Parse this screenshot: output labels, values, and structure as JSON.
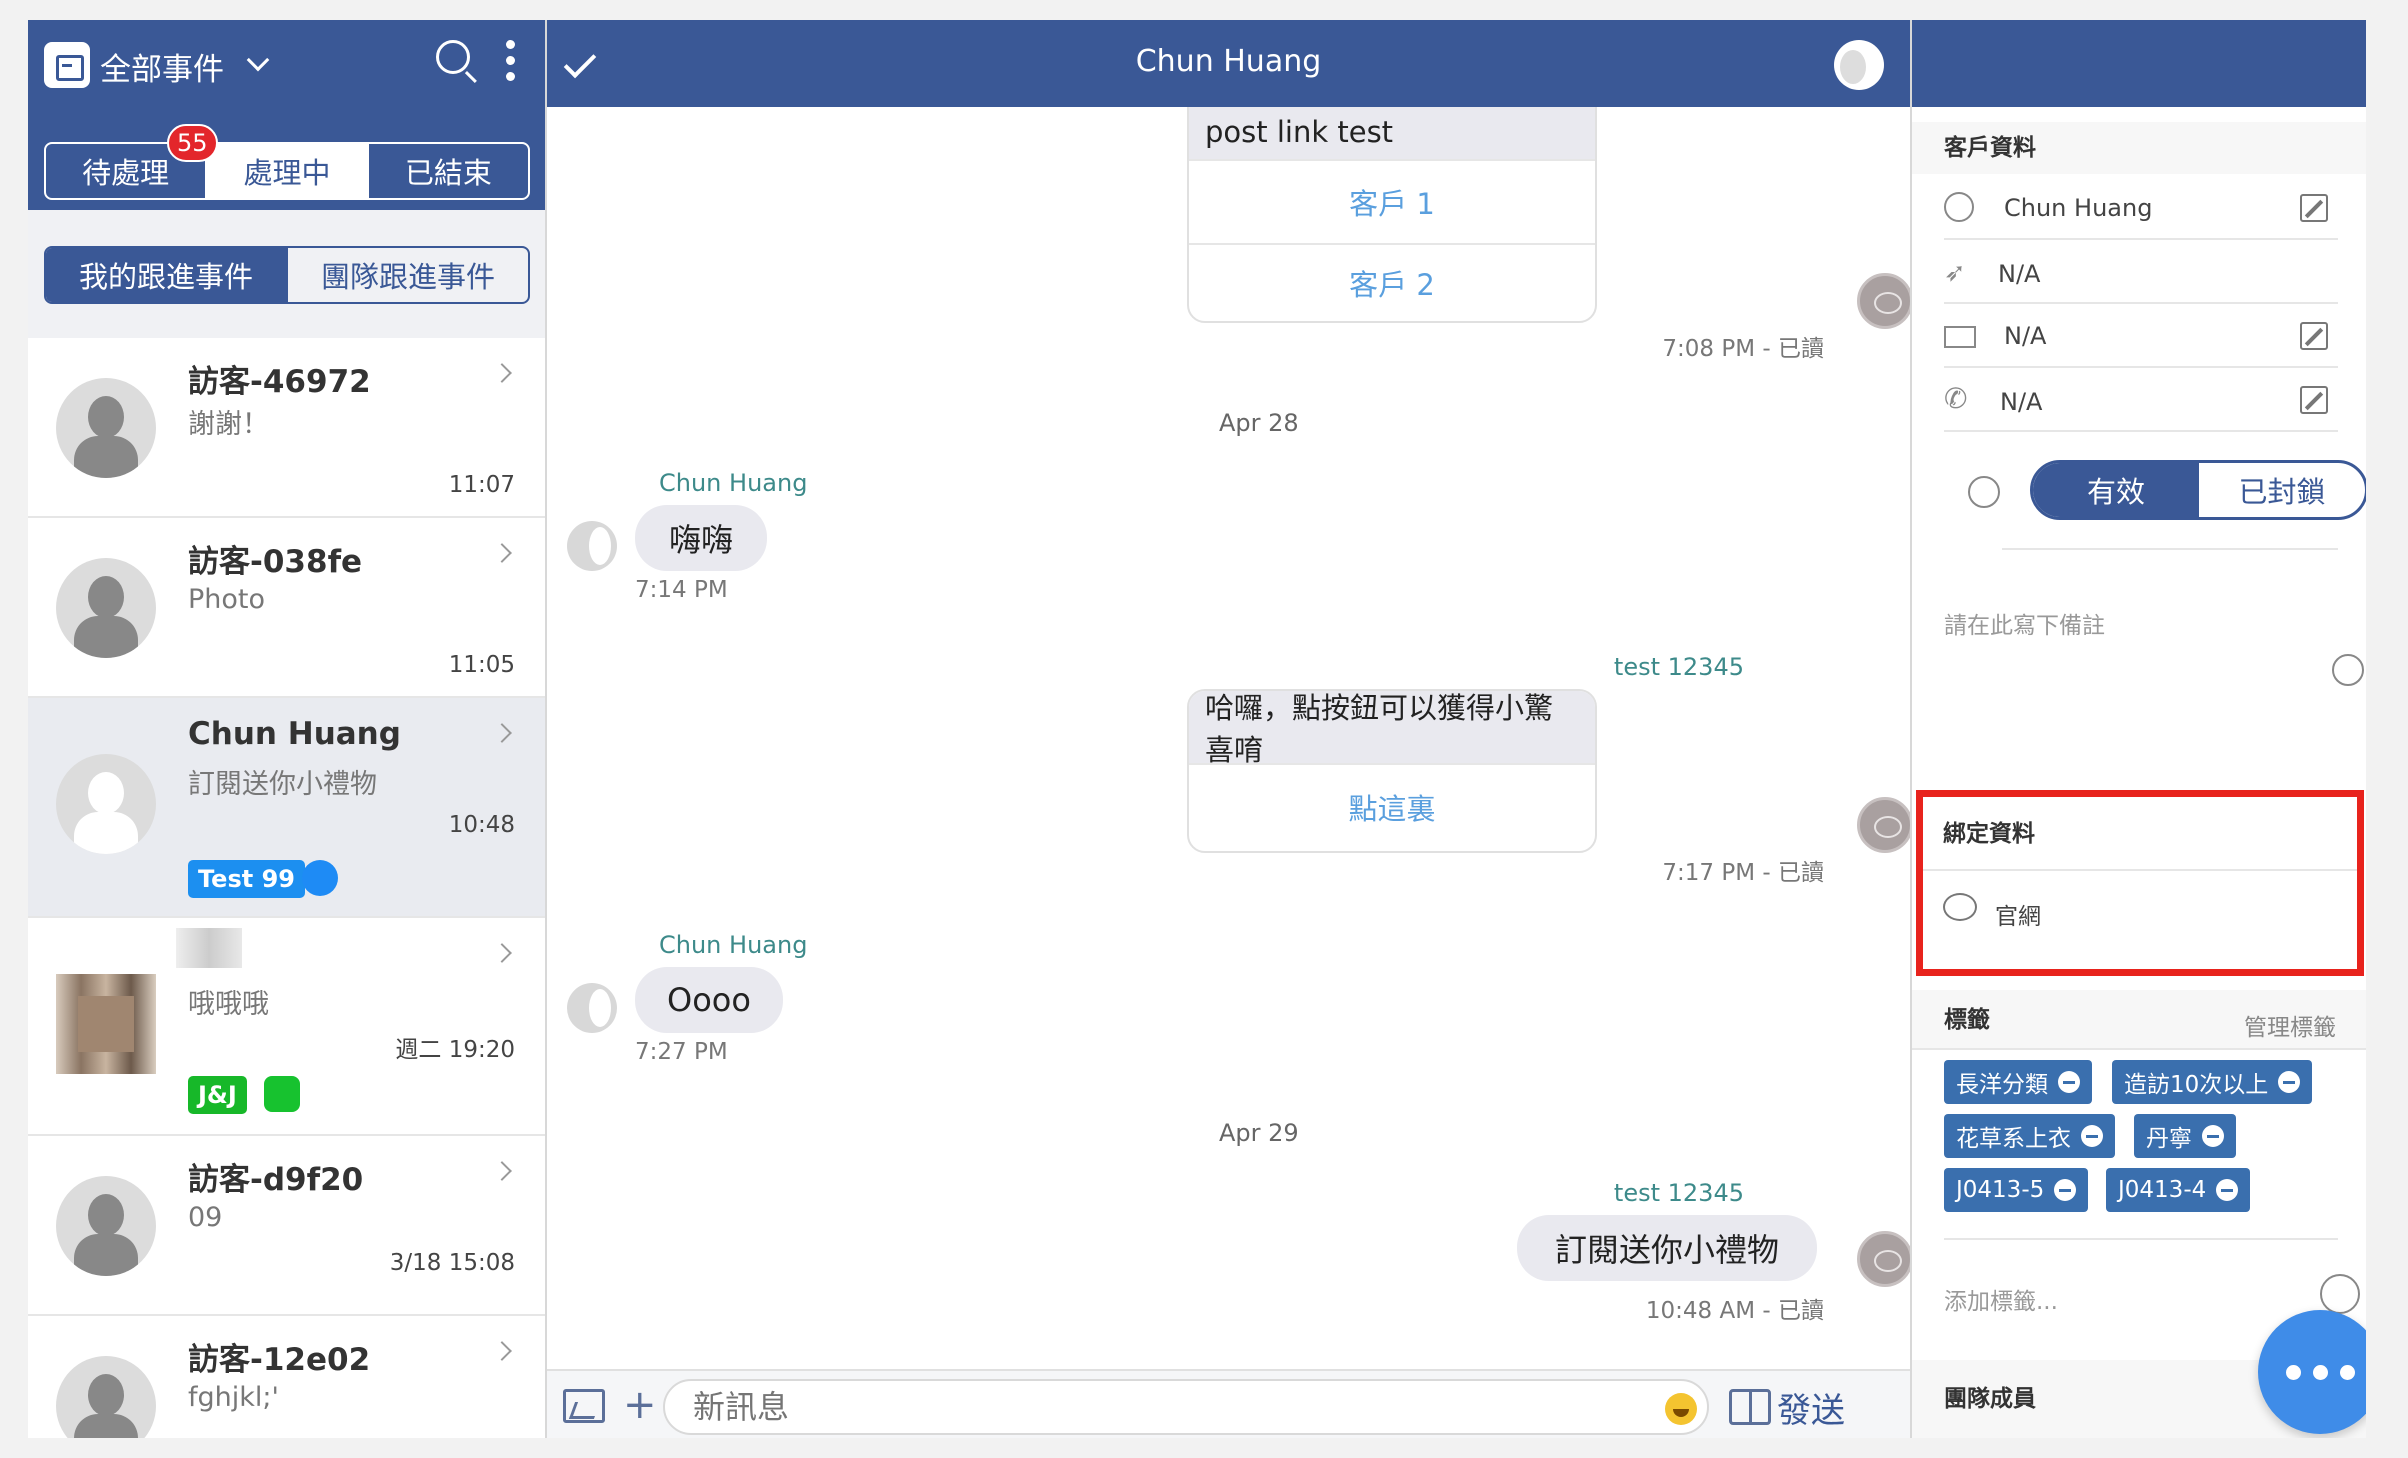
{
  "left": {
    "title": "全部事件",
    "status_tabs": [
      "待處理",
      "處理中",
      "已結束"
    ],
    "pending_badge": "55",
    "follow_tabs": [
      "我的跟進事件",
      "團隊跟進事件"
    ],
    "conversations": [
      {
        "name": "訪客-46972",
        "preview": "謝謝！",
        "time": "11:07"
      },
      {
        "name": "訪客-038fe",
        "preview": "Photo",
        "time": "11:05"
      },
      {
        "name": "Chun Huang",
        "preview": "訂閱送你小禮物",
        "time": "10:48",
        "tag": "Test 99",
        "channel": "messenger-icon"
      },
      {
        "name": "",
        "preview": "哦哦哦",
        "time": "週二 19:20",
        "tag": "J&J",
        "channel": "line-icon"
      },
      {
        "name": "訪客-d9f20",
        "preview": "09",
        "time": "3/18 15:08"
      },
      {
        "name": "訪客-12e02",
        "preview": "fghjkl;'",
        "time": ""
      }
    ]
  },
  "chat": {
    "title": "Chun Huang",
    "messages": {
      "card1_text": "post link test",
      "card1_btn1": "客戶 1",
      "card1_btn2": "客戶 2",
      "card1_meta": "7:08 PM - 已讀",
      "date1": "Apr 28",
      "sender1": "Chun Huang",
      "bubble1": "嗨嗨",
      "time1": "7:14 PM",
      "sender2": "test 12345",
      "card2_text": "哈囉，點按鈕可以獲得小驚喜唷",
      "card2_btn": "點這裏",
      "card2_meta": "7:17 PM - 已讀",
      "sender3": "Chun Huang",
      "bubble3": "Oooo",
      "time3": "7:27 PM",
      "date2": "Apr 29",
      "sender4": "test 12345",
      "bubble4": "訂閱送你小禮物",
      "time4": "10:48 AM - 已讀"
    },
    "input_placeholder": "新訊息",
    "send_label": "發送"
  },
  "right": {
    "customer_header": "客戶資料",
    "name": "Chun Huang",
    "location": "N/A",
    "email": "N/A",
    "phone": "N/A",
    "status_options": [
      "有效",
      "已封鎖"
    ],
    "note_placeholder": "請在此寫下備註",
    "binding_header": "綁定資料",
    "binding_item": "官網",
    "tags_header": "標籤",
    "manage_tags": "管理標籤",
    "tags": [
      "長洋分類",
      "造訪10次以上",
      "花草系上衣",
      "丹寧",
      "J0413-5",
      "J0413-4"
    ],
    "add_tag_placeholder": "添加標籤...",
    "team_header": "團隊成員"
  },
  "colors": {
    "brand": "#3a5896",
    "badge": "#e3262b",
    "link": "#5a9fde",
    "highlight": "#e8231d",
    "tag": "#3a6fae",
    "fab": "#3f8ce8"
  }
}
